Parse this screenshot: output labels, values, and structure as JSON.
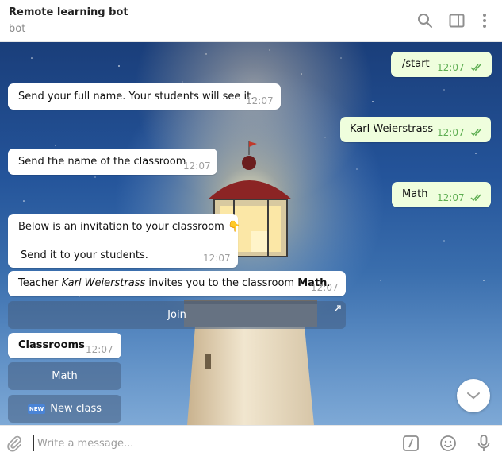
{
  "header": {
    "title": "Remote learning bot",
    "subtitle": "bot",
    "icons": [
      "search-icon",
      "sidebar-toggle-icon",
      "more-vertical-icon"
    ]
  },
  "messages": [
    {
      "dir": "out",
      "text": "/start",
      "time": "12:07",
      "status": "read"
    },
    {
      "dir": "in",
      "text": "Send your full name. Your students will see it.",
      "time": "12:07"
    },
    {
      "dir": "out",
      "text": "Karl Weierstrass",
      "time": "12:07",
      "status": "read"
    },
    {
      "dir": "in",
      "text": "Send the name of the classroom",
      "time": "12:07"
    },
    {
      "dir": "out",
      "text": "Math",
      "time": "12:07",
      "status": "read"
    },
    {
      "dir": "in",
      "line1": "Below is an invitation to your classroom",
      "emoji": "👇",
      "line2": "Send it to your students.",
      "time": "12:07"
    },
    {
      "dir": "in",
      "prefix": "Teacher ",
      "name": "Karl Weierstrass",
      "middle": " invites you to the classroom ",
      "classroom": "Math",
      "suffix": ".",
      "time": "12:07"
    },
    {
      "dir": "in",
      "text": "Classrooms",
      "time": "12:07"
    }
  ],
  "buttons": {
    "join": "Join",
    "math": "Math",
    "new_badge": "NEW",
    "new_class": "New class"
  },
  "composer": {
    "placeholder": "Write a message..."
  },
  "colors": {
    "outgoing_bubble": "#effedd",
    "incoming_bubble": "#ffffff",
    "read_ticks": "#5fae53",
    "timestamp": "#a0a0a0"
  }
}
